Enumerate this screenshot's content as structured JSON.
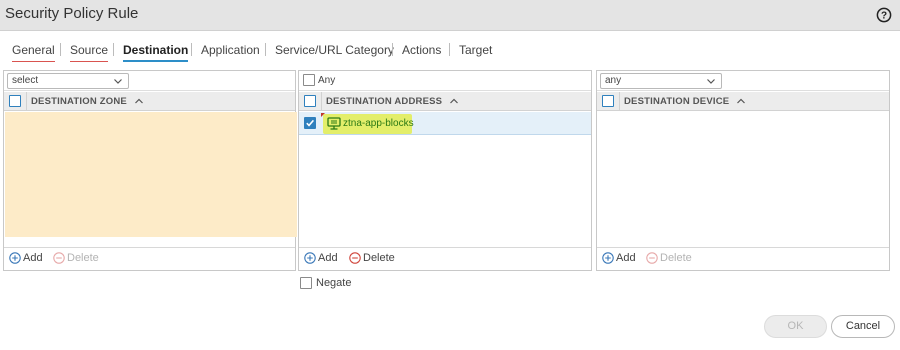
{
  "dialog": {
    "title": "Security Policy Rule"
  },
  "tabs": [
    {
      "label": "General"
    },
    {
      "label": "Source"
    },
    {
      "label": "Destination"
    },
    {
      "label": "Application"
    },
    {
      "label": "Service/URL Category"
    },
    {
      "label": "Actions"
    },
    {
      "label": "Target"
    }
  ],
  "zone_panel": {
    "select_value": "select",
    "column_header": "DESTINATION ZONE",
    "add_label": "Add",
    "delete_label": "Delete"
  },
  "address_panel": {
    "any_label": "Any",
    "column_header": "DESTINATION ADDRESS",
    "rows": [
      {
        "name": "ztna-app-blocks",
        "checked": true
      }
    ],
    "add_label": "Add",
    "delete_label": "Delete"
  },
  "device_panel": {
    "select_value": "any",
    "column_header": "DESTINATION DEVICE",
    "add_label": "Add",
    "delete_label": "Delete"
  },
  "negate": {
    "label": "Negate"
  },
  "buttons": {
    "ok": "OK",
    "cancel": "Cancel"
  },
  "colors": {
    "accent": "#2d8ec8",
    "zone_body_bg": "#fdebc8",
    "address_highlight": "#e3ee6a",
    "error_underline": "#d9534f"
  }
}
